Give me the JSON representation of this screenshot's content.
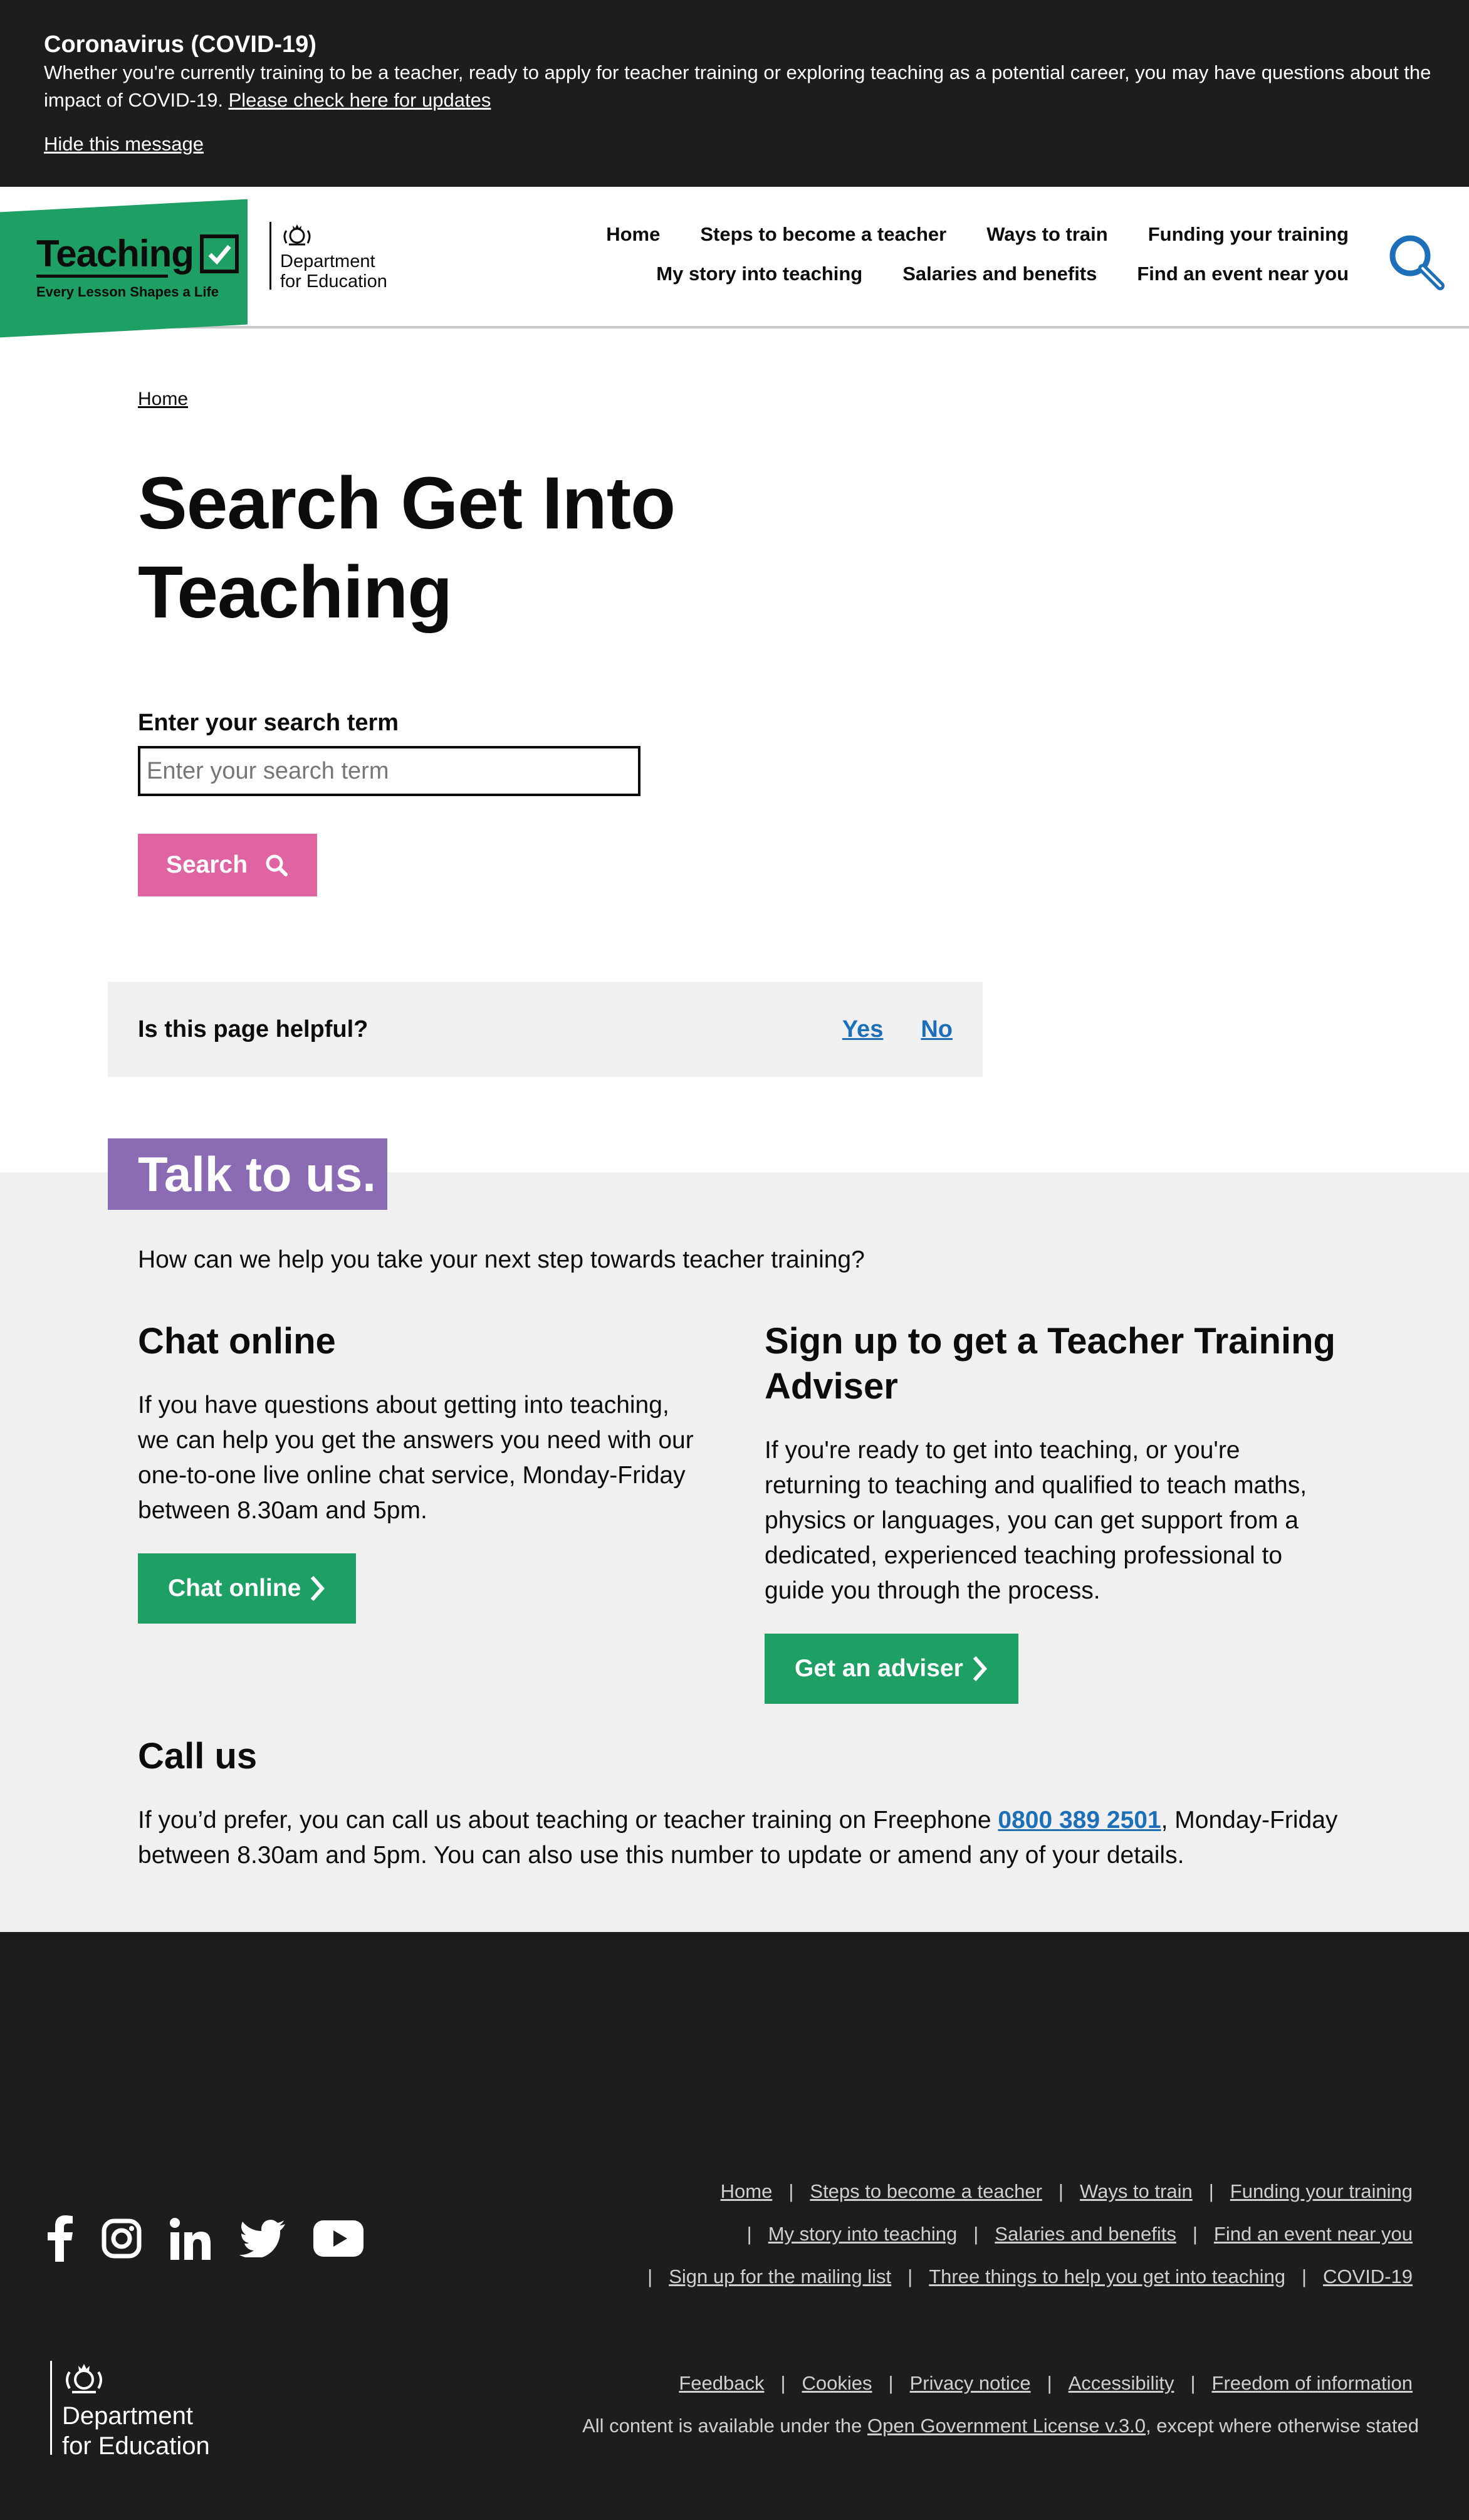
{
  "covid_banner": {
    "title": "Coronavirus (COVID-19)",
    "message": "Whether you're currently training to be a teacher, ready to apply for teacher training or exploring teaching as a potential career, you may have questions about the impact of COVID-19.",
    "link": "Please check here for updates",
    "hide": "Hide this message"
  },
  "header": {
    "logo_word": "Teaching",
    "logo_tagline": "Every Lesson Shapes a Life",
    "dept_line1": "Department",
    "dept_line2": "for Education",
    "nav_row1": [
      "Home",
      "Steps to become a teacher",
      "Ways to train",
      "Funding your training"
    ],
    "nav_row2": [
      "My story into teaching",
      "Salaries and benefits",
      "Find an event near you"
    ]
  },
  "breadcrumb": "Home",
  "page_title": "Search Get Into Teaching",
  "search": {
    "label": "Enter your search term",
    "placeholder": "Enter your search term",
    "button": "Search"
  },
  "feedback": {
    "question": "Is this page helpful?",
    "yes": "Yes",
    "no": "No"
  },
  "talk": {
    "badge": "Talk to us.",
    "intro": "How can we help you take your next step towards teacher training?",
    "chat": {
      "heading": "Chat online",
      "body": "If you have questions about getting into teaching, we can help you get the answers you need with our one-to-one live online chat service, Monday-Friday between 8.30am and 5pm.",
      "button": "Chat online"
    },
    "adviser": {
      "heading": "Sign up to get a Teacher Training Adviser",
      "body": "If you're ready to get into teaching, or you're returning to teaching and qualified to teach maths, physics or languages, you can get support from a dedicated, experienced teaching professional to guide you through the process.",
      "button": "Get an adviser"
    },
    "call": {
      "heading": "Call us",
      "body_before": "If you’d prefer, you can call us about teaching or teacher training on Freephone ",
      "phone": "0800 389 2501",
      "body_after": ", Monday-Friday between 8.30am and 5pm. You can also use this number to update or amend any of your details."
    }
  },
  "footer": {
    "social_icons": [
      "facebook-icon",
      "instagram-icon",
      "linkedin-icon",
      "twitter-icon",
      "youtube-icon"
    ],
    "links_row1": [
      "Home",
      "Steps to become a teacher",
      "Ways to train",
      "Funding your training"
    ],
    "links_row2": [
      "My story into teaching",
      "Salaries and benefits",
      "Find an event near you"
    ],
    "links_row3": [
      "Sign up for the mailing list",
      "Three things to help you get into teaching",
      "COVID-19"
    ],
    "links_row4": [
      "Feedback",
      "Cookies",
      "Privacy notice",
      "Accessibility",
      "Freedom of information"
    ],
    "dept_line1": "Department",
    "dept_line2": "for Education",
    "licence_before": "All content is available under the ",
    "licence_link": "Open Government License v.3.0",
    "licence_after": ", except where otherwise stated"
  },
  "colors": {
    "banner_bg": "#1d1d1d",
    "brand_green": "#1e9f64",
    "search_pink": "#e064a2",
    "talk_purple": "#8a6bb4",
    "link_blue": "#1d70b8",
    "panel_grey": "#f0f0f0"
  }
}
